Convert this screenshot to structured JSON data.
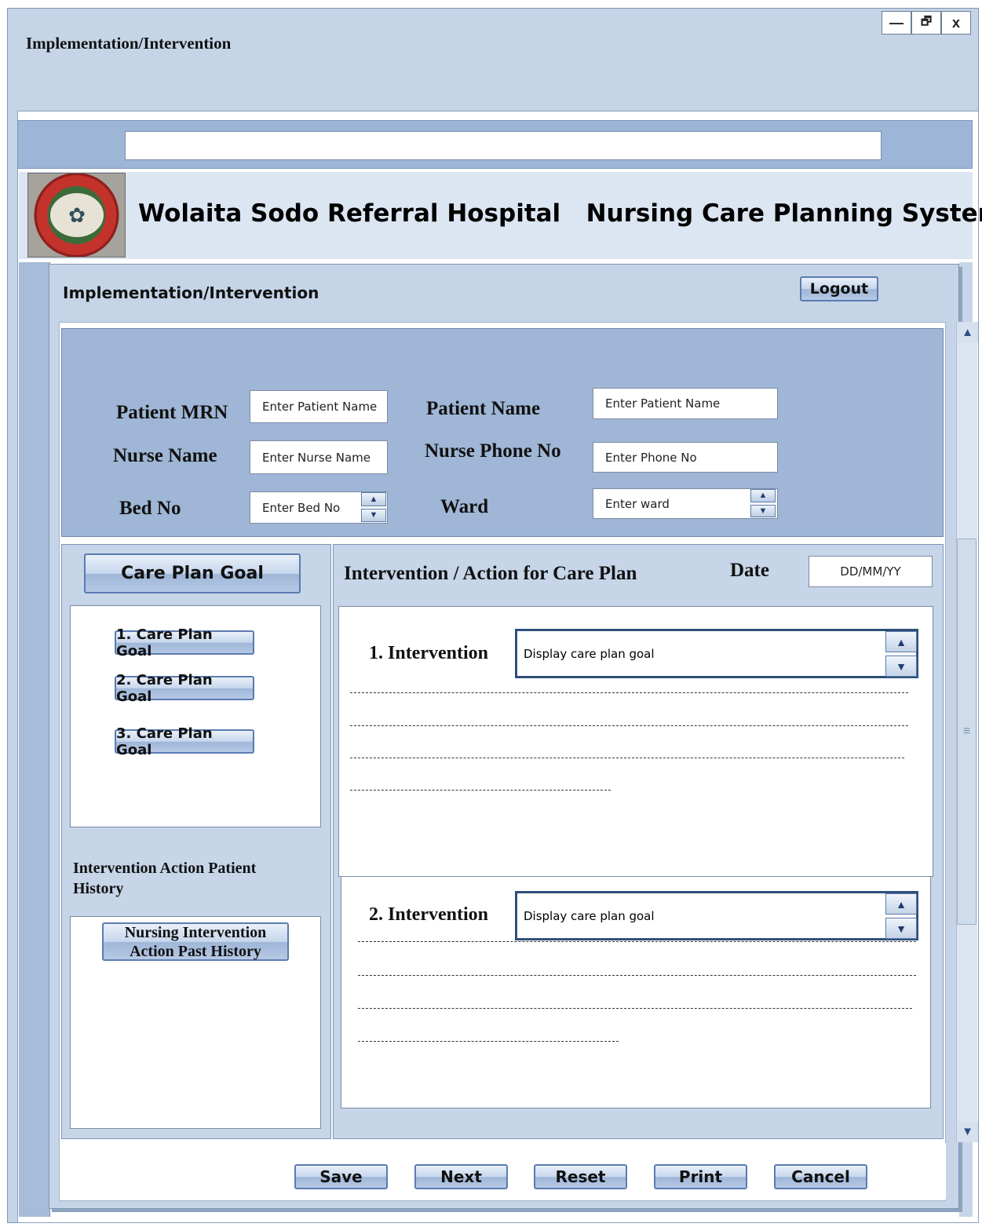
{
  "window": {
    "title": "Implementation/Intervention",
    "controls": {
      "minimize": "—",
      "restore": "🗗",
      "close": "x"
    }
  },
  "header": {
    "hospital_title": "Wolaita Sodo Referral Hospital   Nursing Care Planning System",
    "logo_icon": "university-seal-icon"
  },
  "panel": {
    "title": "Implementation/Intervention",
    "logout_label": "Logout"
  },
  "patient": {
    "mrn_label": "Patient MRN",
    "mrn_placeholder": "Enter Patient Name",
    "name_label": "Patient Name",
    "name_placeholder": "Enter Patient Name",
    "nurse_label": "Nurse Name",
    "nurse_placeholder": "Enter Nurse Name",
    "phone_label": "Nurse Phone No",
    "phone_placeholder": "Enter Phone No",
    "bed_label": "Bed No",
    "bed_placeholder": "Enter Bed No",
    "ward_label": "Ward",
    "ward_placeholder": "Enter ward"
  },
  "goals": {
    "header": "Care Plan Goal",
    "items": [
      "1. Care Plan Goal",
      "2. Care Plan Goal",
      "3. Care Plan Goal"
    ]
  },
  "history": {
    "title": "Intervention Action Patient History",
    "button_line1": "Nursing Intervention",
    "button_line2": "Action Past History"
  },
  "intervention": {
    "title": "Intervention / Action for Care Plan",
    "date_label": "Date",
    "date_placeholder": "DD/MM/YY",
    "items": [
      {
        "label": "1. Intervention",
        "value": "Display care plan goal"
      },
      {
        "label": "2. Intervention",
        "value": "Display care plan goal"
      }
    ]
  },
  "actions": {
    "save": "Save",
    "next": "Next",
    "reset": "Reset",
    "print": "Print",
    "cancel": "Cancel"
  },
  "colors": {
    "panel_blue": "#c5d4e7",
    "patient_box": "#9fb6d6",
    "button_border": "#5b7bb0"
  }
}
